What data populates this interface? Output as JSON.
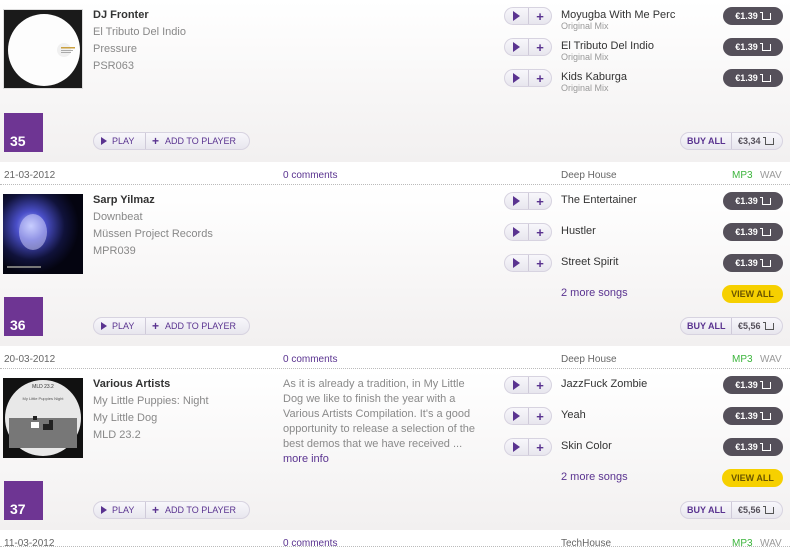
{
  "releases": [
    {
      "number": "35",
      "artist": "DJ Fronter",
      "title": "El Tributo Del Indio",
      "label": "Pressure",
      "catalog": "PSR063",
      "tracks": [
        {
          "title": "Moyugba With Me Perc",
          "mix": "Original Mix",
          "price": "€1.39"
        },
        {
          "title": "El Tributo Del Indio",
          "mix": "Original Mix",
          "price": "€1.39"
        },
        {
          "title": "Kids Kaburga",
          "mix": "Original Mix",
          "price": "€1.39"
        }
      ],
      "play_label": "PLAY",
      "add_label": "ADD TO PLAYER",
      "buy_all_label": "BUY ALL",
      "buy_all_price": "€3,34"
    },
    {
      "date": "21-03-2012",
      "comments": "0 comments",
      "genre": "Deep House",
      "mp3": "MP3",
      "wav": "WAV",
      "number": "36",
      "artist": "Sarp Yilmaz",
      "title": "Downbeat",
      "label": "Müssen Project Records",
      "catalog": "MPR039",
      "tracks": [
        {
          "title": "The Entertainer",
          "price": "€1.39"
        },
        {
          "title": "Hustler",
          "price": "€1.39"
        },
        {
          "title": "Street Spirit",
          "price": "€1.39"
        }
      ],
      "more_songs": "2 more songs",
      "view_all": "VIEW ALL",
      "play_label": "PLAY",
      "add_label": "ADD TO PLAYER",
      "buy_all_label": "BUY ALL",
      "buy_all_price": "€5,56"
    },
    {
      "date": "20-03-2012",
      "comments": "0 comments",
      "genre": "Deep House",
      "mp3": "MP3",
      "wav": "WAV",
      "number": "37",
      "artist": "Various Artists",
      "title": "My Little Puppies: Night",
      "label": "My Little Dog",
      "catalog": "MLD 23.2",
      "description": "As it is already a tradition, in My Little Dog we like to finish the year with a Various Artists Compilation. It's a good opportunity to release a selection of the best demos that we have received ...",
      "more_info": "more info",
      "cover_text_top": "MLD 23.2",
      "cover_text": "My Little Puppies Night",
      "tracks": [
        {
          "title": "JazzFuck Zombie",
          "price": "€1.39"
        },
        {
          "title": "Yeah",
          "price": "€1.39"
        },
        {
          "title": "Skin Color",
          "price": "€1.39"
        }
      ],
      "more_songs": "2 more songs",
      "view_all": "VIEW ALL",
      "play_label": "PLAY",
      "add_label": "ADD TO PLAYER",
      "buy_all_label": "BUY ALL",
      "buy_all_price": "€5,56"
    },
    {
      "date": "11-03-2012",
      "comments": "0 comments",
      "genre": "TechHouse",
      "mp3": "MP3",
      "wav": "WAV"
    }
  ],
  "colors": {
    "accent": "#6e3593",
    "mp3": "#3cb53c",
    "price_bg": "#55505a",
    "view_all": "#f6d000"
  }
}
